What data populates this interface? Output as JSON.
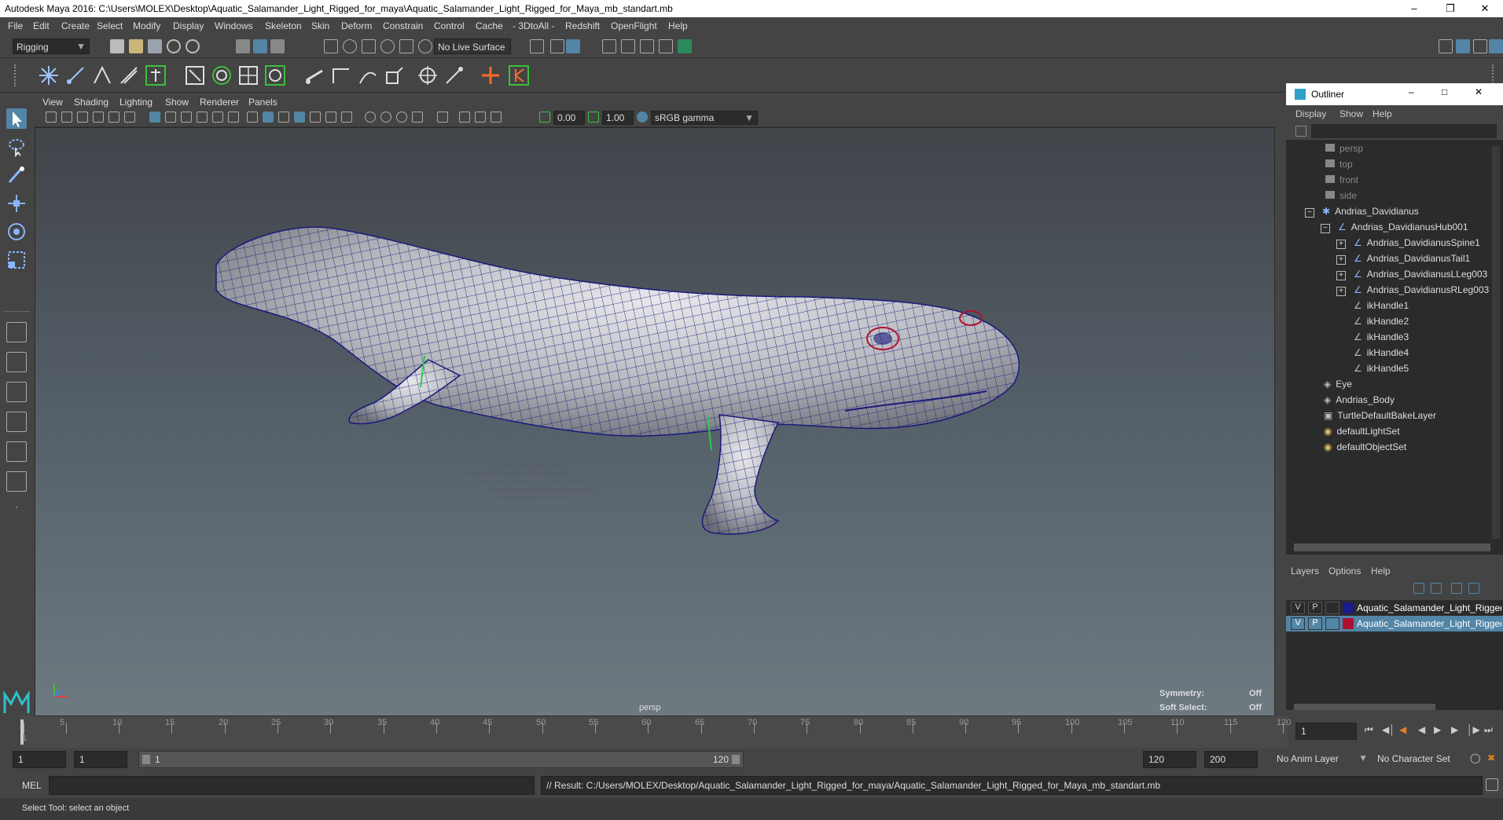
{
  "app": {
    "title": "Autodesk Maya 2016: C:\\Users\\MOLEX\\Desktop\\Aquatic_Salamander_Light_Rigged_for_maya\\Aquatic_Salamander_Light_Rigged_for_Maya_mb_standart.mb",
    "window_buttons": {
      "minimize": "–",
      "restore": "❐",
      "close": "✕"
    }
  },
  "menubar": [
    "File",
    "Edit",
    "Create",
    "Select",
    "Modify",
    "Display",
    "Windows",
    "Skeleton",
    "Skin",
    "Deform",
    "Constrain",
    "Control",
    "Cache",
    "- 3DtoAll -",
    "Redshift",
    "OpenFlight",
    "Help"
  ],
  "status_line": {
    "mode": "Rigging",
    "live_surface": "No Live Surface"
  },
  "panel": {
    "menus": [
      "View",
      "Shading",
      "Lighting",
      "Show",
      "Renderer",
      "Panels"
    ],
    "near_value": "0.00",
    "far_value": "1.00",
    "color_space": "sRGB gamma"
  },
  "viewport": {
    "camera_label": "persp",
    "symmetry_label": "Symmetry:",
    "symmetry_value": "Off",
    "soft_select_label": "Soft Select:",
    "soft_select_value": "Off",
    "axis": {
      "x": "x",
      "y": "y",
      "z": "z"
    }
  },
  "outliner": {
    "title": "Outliner",
    "menus": [
      "Display",
      "Show",
      "Help"
    ],
    "items": [
      {
        "label": "persp",
        "dim": true,
        "indent": 0
      },
      {
        "label": "top",
        "dim": true,
        "indent": 0
      },
      {
        "label": "front",
        "dim": true,
        "indent": 0
      },
      {
        "label": "side",
        "dim": true,
        "indent": 0
      },
      {
        "label": "Andrias_Davidianus",
        "dim": false,
        "indent": 0,
        "expander": "minus"
      },
      {
        "label": "Andrias_DavidianusHub001",
        "dim": false,
        "indent": 1,
        "expander": "minus"
      },
      {
        "label": "Andrias_DavidianusSpine1",
        "dim": false,
        "indent": 2,
        "expander": "plus"
      },
      {
        "label": "Andrias_DavidianusTail1",
        "dim": false,
        "indent": 2,
        "expander": "plus"
      },
      {
        "label": "Andrias_DavidianusLLeg003",
        "dim": false,
        "indent": 2,
        "expander": "plus"
      },
      {
        "label": "Andrias_DavidianusRLeg003",
        "dim": false,
        "indent": 2,
        "expander": "plus"
      },
      {
        "label": "ikHandle1",
        "dim": false,
        "indent": 2
      },
      {
        "label": "ikHandle2",
        "dim": false,
        "indent": 2
      },
      {
        "label": "ikHandle3",
        "dim": false,
        "indent": 2
      },
      {
        "label": "ikHandle4",
        "dim": false,
        "indent": 2
      },
      {
        "label": "ikHandle5",
        "dim": false,
        "indent": 2
      },
      {
        "label": "Eye",
        "dim": false,
        "indent": 0
      },
      {
        "label": "Andrias_Body",
        "dim": false,
        "indent": 0
      },
      {
        "label": "TurtleDefaultBakeLayer",
        "dim": false,
        "indent": 0
      },
      {
        "label": "defaultLightSet",
        "dim": false,
        "indent": 0
      },
      {
        "label": "defaultObjectSet",
        "dim": false,
        "indent": 0
      }
    ]
  },
  "layers": {
    "menus": [
      "Layers",
      "Options",
      "Help"
    ],
    "rows": [
      {
        "v": "V",
        "p": "P",
        "name": "Aquatic_Salamander_Light_Rigged",
        "color": "#1a1a8c",
        "selected": false
      },
      {
        "v": "V",
        "p": "P",
        "name": "Aquatic_Salamander_Light_Rigged",
        "color": "#b01030",
        "selected": true
      }
    ]
  },
  "timeline": {
    "ticks": [
      "1",
      "5",
      "10",
      "15",
      "20",
      "25",
      "30",
      "35",
      "40",
      "45",
      "50",
      "55",
      "60",
      "65",
      "70",
      "75",
      "80",
      "85",
      "90",
      "95",
      "100",
      "105",
      "110",
      "115",
      "120"
    ],
    "current_frame": "1"
  },
  "range": {
    "start": "1",
    "playback_start": "1",
    "slider_start": "1",
    "slider_end": "120",
    "playback_end": "120",
    "end": "200",
    "anim_layer": "No Anim Layer",
    "character_set": "No Character Set"
  },
  "cmdline": {
    "language": "MEL",
    "result": "// Result: C:/Users/MOLEX/Desktop/Aquatic_Salamander_Light_Rigged_for_maya/Aquatic_Salamander_Light_Rigged_for_Maya_mb_standart.mb"
  },
  "helpline": "Select Tool: select an object",
  "colors": {
    "accent": "#5285a6",
    "selection": "#5285a6",
    "mesh_wire": "#1a1a7a"
  }
}
